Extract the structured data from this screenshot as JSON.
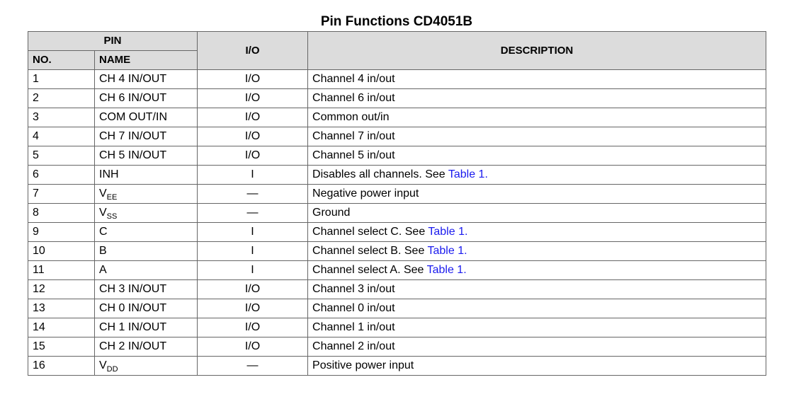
{
  "title": "Pin Functions CD4051B",
  "header": {
    "pin_group": "PIN",
    "no": "NO.",
    "name": "NAME",
    "io": "I/O",
    "description": "DESCRIPTION"
  },
  "link_color": "#1a1aee",
  "rows": [
    {
      "no": "1",
      "name_main": "CH 4 IN/OUT",
      "name_sub": "",
      "io": "I/O",
      "desc": "Channel 4 in/out",
      "desc_link": "",
      "desc_tail": ""
    },
    {
      "no": "2",
      "name_main": "CH 6 IN/OUT",
      "name_sub": "",
      "io": "I/O",
      "desc": "Channel 6 in/out",
      "desc_link": "",
      "desc_tail": ""
    },
    {
      "no": "3",
      "name_main": "COM OUT/IN",
      "name_sub": "",
      "io": "I/O",
      "desc": "Common out/in",
      "desc_link": "",
      "desc_tail": ""
    },
    {
      "no": "4",
      "name_main": "CH 7 IN/OUT",
      "name_sub": "",
      "io": "I/O",
      "desc": "Channel 7 in/out",
      "desc_link": "",
      "desc_tail": ""
    },
    {
      "no": "5",
      "name_main": "CH 5 IN/OUT",
      "name_sub": "",
      "io": "I/O",
      "desc": "Channel 5 in/out",
      "desc_link": "",
      "desc_tail": ""
    },
    {
      "no": "6",
      "name_main": "INH",
      "name_sub": "",
      "io": "I",
      "desc": "Disables all channels. See ",
      "desc_link": "Table 1",
      "desc_tail": "."
    },
    {
      "no": "7",
      "name_main": "V",
      "name_sub": "EE",
      "io": "—",
      "desc": "Negative power input",
      "desc_link": "",
      "desc_tail": ""
    },
    {
      "no": "8",
      "name_main": "V",
      "name_sub": "SS",
      "io": "—",
      "desc": "Ground",
      "desc_link": "",
      "desc_tail": ""
    },
    {
      "no": "9",
      "name_main": "C",
      "name_sub": "",
      "io": "I",
      "desc": "Channel select C. See ",
      "desc_link": "Table 1",
      "desc_tail": "."
    },
    {
      "no": "10",
      "name_main": "B",
      "name_sub": "",
      "io": "I",
      "desc": "Channel select B. See ",
      "desc_link": "Table 1",
      "desc_tail": "."
    },
    {
      "no": "11",
      "name_main": "A",
      "name_sub": "",
      "io": "I",
      "desc": "Channel select A. See ",
      "desc_link": "Table 1",
      "desc_tail": "."
    },
    {
      "no": "12",
      "name_main": "CH 3 IN/OUT",
      "name_sub": "",
      "io": "I/O",
      "desc": "Channel 3 in/out",
      "desc_link": "",
      "desc_tail": ""
    },
    {
      "no": "13",
      "name_main": "CH 0 IN/OUT",
      "name_sub": "",
      "io": "I/O",
      "desc": "Channel 0 in/out",
      "desc_link": "",
      "desc_tail": ""
    },
    {
      "no": "14",
      "name_main": "CH 1 IN/OUT",
      "name_sub": "",
      "io": "I/O",
      "desc": "Channel 1 in/out",
      "desc_link": "",
      "desc_tail": ""
    },
    {
      "no": "15",
      "name_main": "CH 2 IN/OUT",
      "name_sub": "",
      "io": "I/O",
      "desc": "Channel 2 in/out",
      "desc_link": "",
      "desc_tail": ""
    },
    {
      "no": "16",
      "name_main": "V",
      "name_sub": "DD",
      "io": "—",
      "desc": "Positive power input",
      "desc_link": "",
      "desc_tail": ""
    }
  ]
}
